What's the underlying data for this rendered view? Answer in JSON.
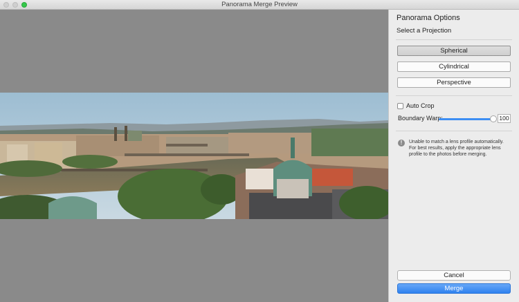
{
  "window": {
    "title": "Panorama Merge Preview"
  },
  "panel": {
    "title": "Panorama Options",
    "subtitle": "Select a Projection",
    "projections": [
      {
        "label": "Spherical",
        "selected": true
      },
      {
        "label": "Cylindrical",
        "selected": false
      },
      {
        "label": "Perspective",
        "selected": false
      }
    ],
    "auto_crop": {
      "label": "Auto Crop",
      "checked": false
    },
    "boundary_warp": {
      "label": "Boundary Warp:",
      "value": "100",
      "level": 1.0
    },
    "warning": {
      "icon": "exclamation-icon",
      "text": "Unable to match a lens profile automatically. For best results, apply the appropriate lens profile to the photos before merging."
    },
    "cancel_label": "Cancel",
    "merge_label": "Merge"
  },
  "colors": {
    "accent": "#3d8ef3",
    "preview_bg": "#8a8a8a",
    "panel_bg": "#ececec"
  }
}
